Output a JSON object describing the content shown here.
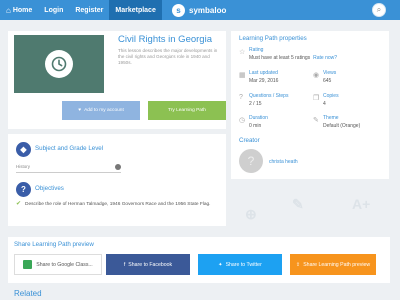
{
  "nav": {
    "home": "Home",
    "login": "Login",
    "register": "Register",
    "marketplace": "Marketplace",
    "brand": "symbaloo"
  },
  "hero": {
    "title": "Civil Rights in Georgia",
    "description": "This lesson describes the major developments in the civil rights and Georgia's role in 1940 and 1950s.",
    "add_label": "Add to my account",
    "try_label": "Try Learning Path"
  },
  "subject": {
    "label": "Subject and Grade Level",
    "value": "History"
  },
  "objectives": {
    "label": "Objectives",
    "items": [
      "Describe the role of Herman Talmadge, 1946 Governors Race and the 1956 State Flag."
    ]
  },
  "properties": {
    "title": "Learning Path properties",
    "rating_label": "Rating",
    "rating_value": "Must have at least 5 ratings",
    "rate_link": "Rate now?",
    "updated_label": "Last updated",
    "updated_value": "Mar 29, 2016",
    "views_label": "Views",
    "views_value": "645",
    "questions_label": "Questions / Steps",
    "questions_value": "2 / 15",
    "copies_label": "Copies",
    "copies_value": "4",
    "duration_label": "Duration",
    "duration_value": "0 min",
    "theme_label": "Theme",
    "theme_value": "Default (Orange)"
  },
  "creator": {
    "title": "Creator",
    "name": "christa heath"
  },
  "share": {
    "title": "Share Learning Path preview",
    "google": "Share to Google Class...",
    "facebook": "Share to Facebook",
    "twitter": "Share to Twitter",
    "learning_path": "Share Learning Path preview"
  },
  "related": "Related",
  "colors": {
    "nav": "#3a91d6",
    "accent": "#3a91d6",
    "try_button": "#8cc152",
    "add_button": "#8fb4e0",
    "facebook": "#3b5998",
    "twitter": "#1da1f2",
    "share_lp": "#f7941d"
  }
}
